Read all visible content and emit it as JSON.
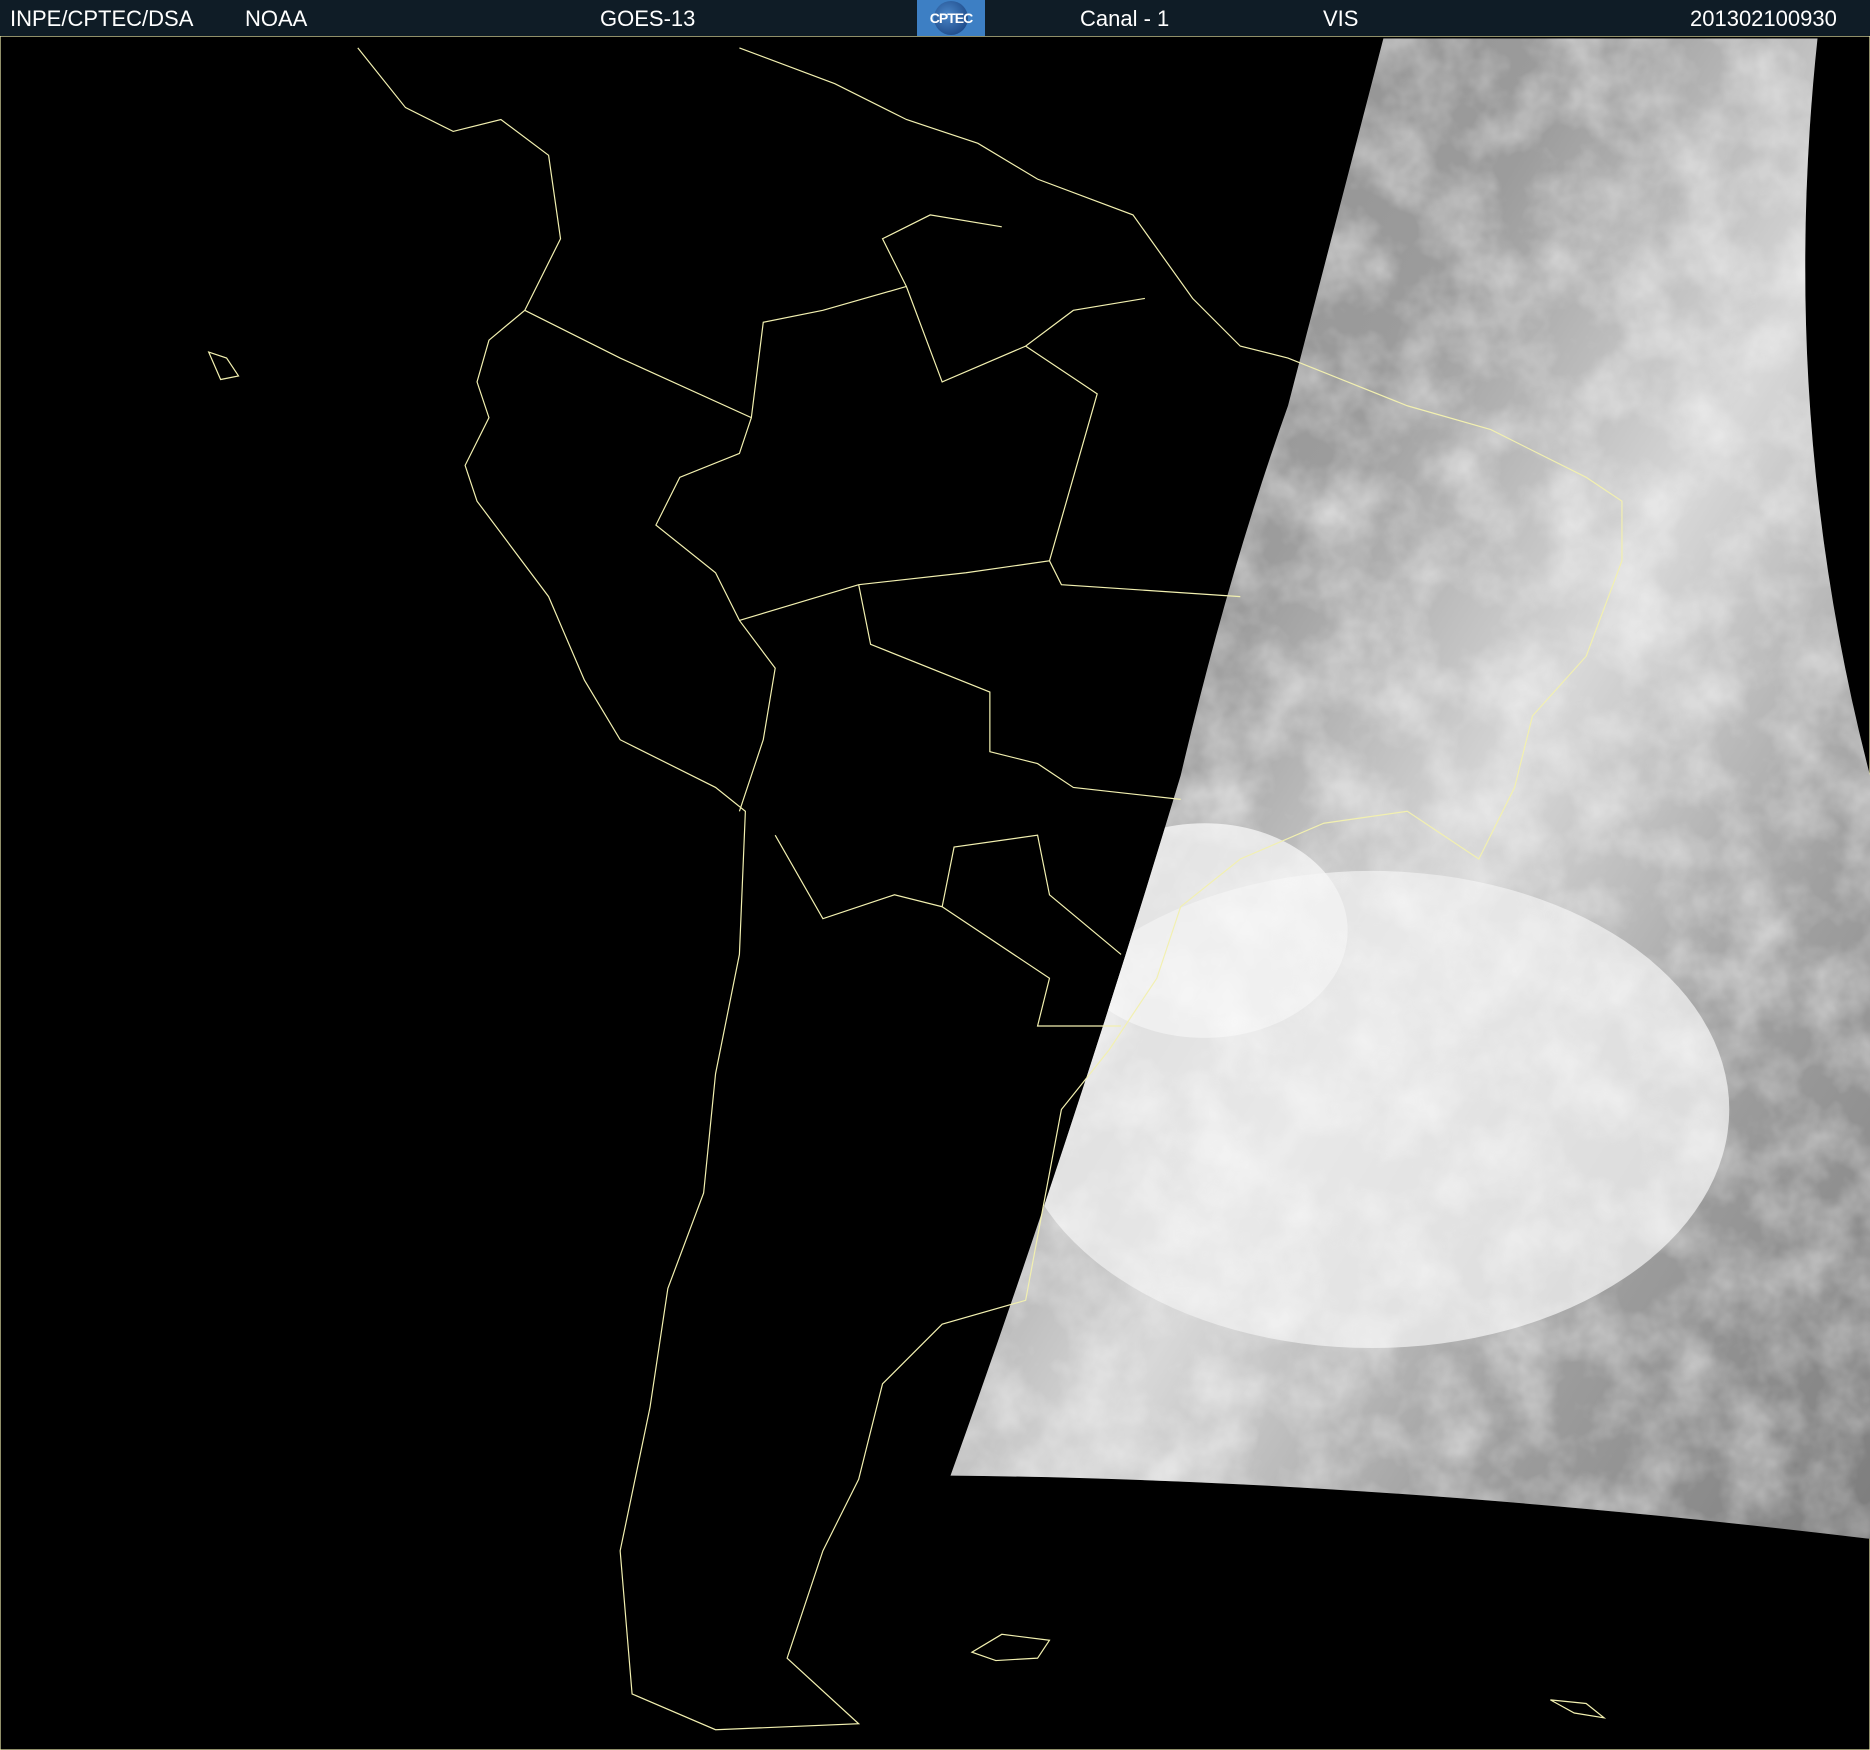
{
  "header": {
    "institution": "INPE/CPTEC/DSA",
    "agency": "NOAA",
    "satellite": "GOES-13",
    "logo_text": "CPTEC",
    "channel": "Canal - 1",
    "band": "VIS",
    "timestamp": "201302100930"
  },
  "colors": {
    "header_bg": "#0f1c26",
    "coastline": "#f2f0b0",
    "background": "#000000"
  }
}
